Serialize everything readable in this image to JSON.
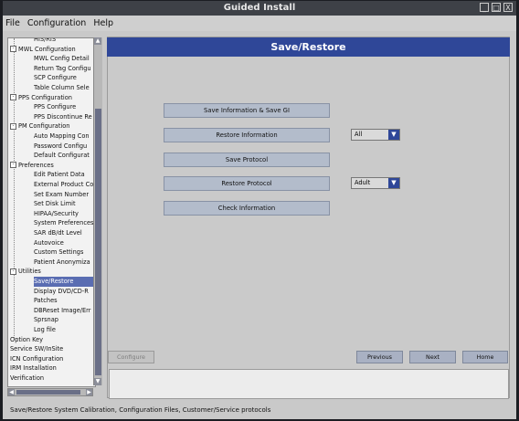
{
  "window": {
    "title": "Guided Install",
    "buttons": [
      "_",
      "□",
      "X"
    ]
  },
  "menu": [
    "File",
    "Configuration",
    "Help"
  ],
  "tree": [
    {
      "label": "HIS/RIS",
      "indent": 2
    },
    {
      "label": "MWL Configuration",
      "indent": 1,
      "exp": true
    },
    {
      "label": "MWL Config Detail",
      "indent": 2
    },
    {
      "label": "Return Tag Configu",
      "indent": 2
    },
    {
      "label": "SCP Configure",
      "indent": 2
    },
    {
      "label": "Table Column Sele",
      "indent": 2
    },
    {
      "label": "PPS Configuration",
      "indent": 1,
      "exp": true
    },
    {
      "label": "PPS Configure",
      "indent": 2
    },
    {
      "label": "PPS Discontinue Re",
      "indent": 2
    },
    {
      "label": "PM Configuration",
      "indent": 1,
      "exp": true
    },
    {
      "label": "Auto Mapping Con",
      "indent": 2
    },
    {
      "label": "Password Configu",
      "indent": 2
    },
    {
      "label": "Default Configurat",
      "indent": 2
    },
    {
      "label": "Preferences",
      "indent": 1,
      "exp": true
    },
    {
      "label": "Edit Patient Data",
      "indent": 2
    },
    {
      "label": "External Product Co",
      "indent": 2
    },
    {
      "label": "Set Exam Number",
      "indent": 2
    },
    {
      "label": "Set Disk Limit",
      "indent": 2
    },
    {
      "label": "HIPAA/Security",
      "indent": 2
    },
    {
      "label": "System Preferences",
      "indent": 2
    },
    {
      "label": "SAR dB/dt Level",
      "indent": 2
    },
    {
      "label": "Autovoice",
      "indent": 2
    },
    {
      "label": "Custom Settings",
      "indent": 2
    },
    {
      "label": "Patient Anonymiza",
      "indent": 2
    },
    {
      "label": "Utilities",
      "indent": 1,
      "exp": true
    },
    {
      "label": "Save/Restore",
      "indent": 2,
      "selected": true
    },
    {
      "label": "Display DVD/CD-R",
      "indent": 2
    },
    {
      "label": "Patches",
      "indent": 2
    },
    {
      "label": "DBReset Image/Err",
      "indent": 2
    },
    {
      "label": "Sprsnap",
      "indent": 2
    },
    {
      "label": "Log file",
      "indent": 2
    },
    {
      "label": "Option Key",
      "indent": 1
    },
    {
      "label": "Service SW/InSite",
      "indent": 1
    },
    {
      "label": "ICN Configuration",
      "indent": 1
    },
    {
      "label": "IRM Installation",
      "indent": 1
    },
    {
      "label": "Verification",
      "indent": 1
    }
  ],
  "panel": {
    "title": "Save/Restore",
    "buttons": {
      "save_info": "Save Information & Save GI",
      "restore_info": "Restore Information",
      "save_protocol": "Save Protocol",
      "restore_protocol": "Restore Protocol",
      "check_info": "Check Information"
    },
    "restore_info_select": "All",
    "restore_protocol_select": "Adult"
  },
  "nav": {
    "configure": "Configure",
    "previous": "Previous",
    "next": "Next",
    "home": "Home"
  },
  "status": "Save/Restore System Calibration, Configuration Files, Customer/Service protocols"
}
